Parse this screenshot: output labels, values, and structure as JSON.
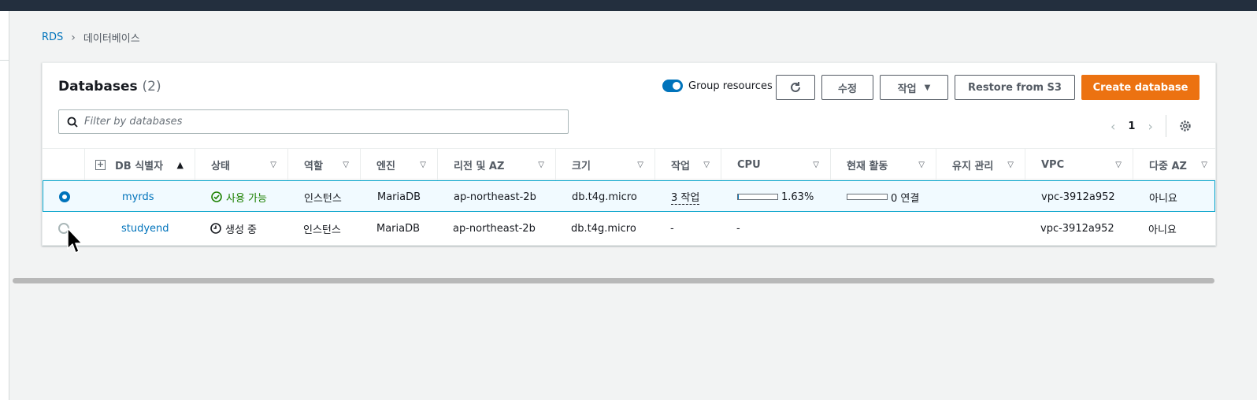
{
  "breadcrumb": {
    "root": "RDS",
    "current": "데이터베이스"
  },
  "panel": {
    "title": "Databases",
    "count": "(2)",
    "group_resources": "Group resources",
    "group_resources_on": true,
    "buttons": {
      "modify": "수정",
      "actions": "작업",
      "restore": "Restore from S3",
      "create": "Create database"
    },
    "search_placeholder": "Filter by databases",
    "page": "1"
  },
  "columns": [
    "DB 식별자",
    "상태",
    "역할",
    "엔진",
    "리전 및 AZ",
    "크기",
    "작업",
    "CPU",
    "현재 활동",
    "유지 관리",
    "VPC",
    "다중 AZ"
  ],
  "rows": [
    {
      "selected": true,
      "id": "myrds",
      "status": "사용 가능",
      "role": "인스턴스",
      "engine": "MariaDB",
      "region": "ap-northeast-2b",
      "size": "db.t4g.micro",
      "actions": "3 작업",
      "cpu": "1.63%",
      "cpu_fraction": 0.0163,
      "activity": "0 연결",
      "maintenance": "",
      "vpc": "vpc-3912a952",
      "multi_az": "아니요"
    },
    {
      "selected": false,
      "id": "studyend",
      "status": "생성 중",
      "role": "인스턴스",
      "engine": "MariaDB",
      "region": "ap-northeast-2b",
      "size": "db.t4g.micro",
      "actions": "-",
      "cpu": "-",
      "activity": "",
      "maintenance": "",
      "vpc": "vpc-3912a952",
      "multi_az": "아니요"
    }
  ],
  "colors": {
    "accent": "#0073bb",
    "primary_button": "#ec7211",
    "available": "#1d8102"
  }
}
